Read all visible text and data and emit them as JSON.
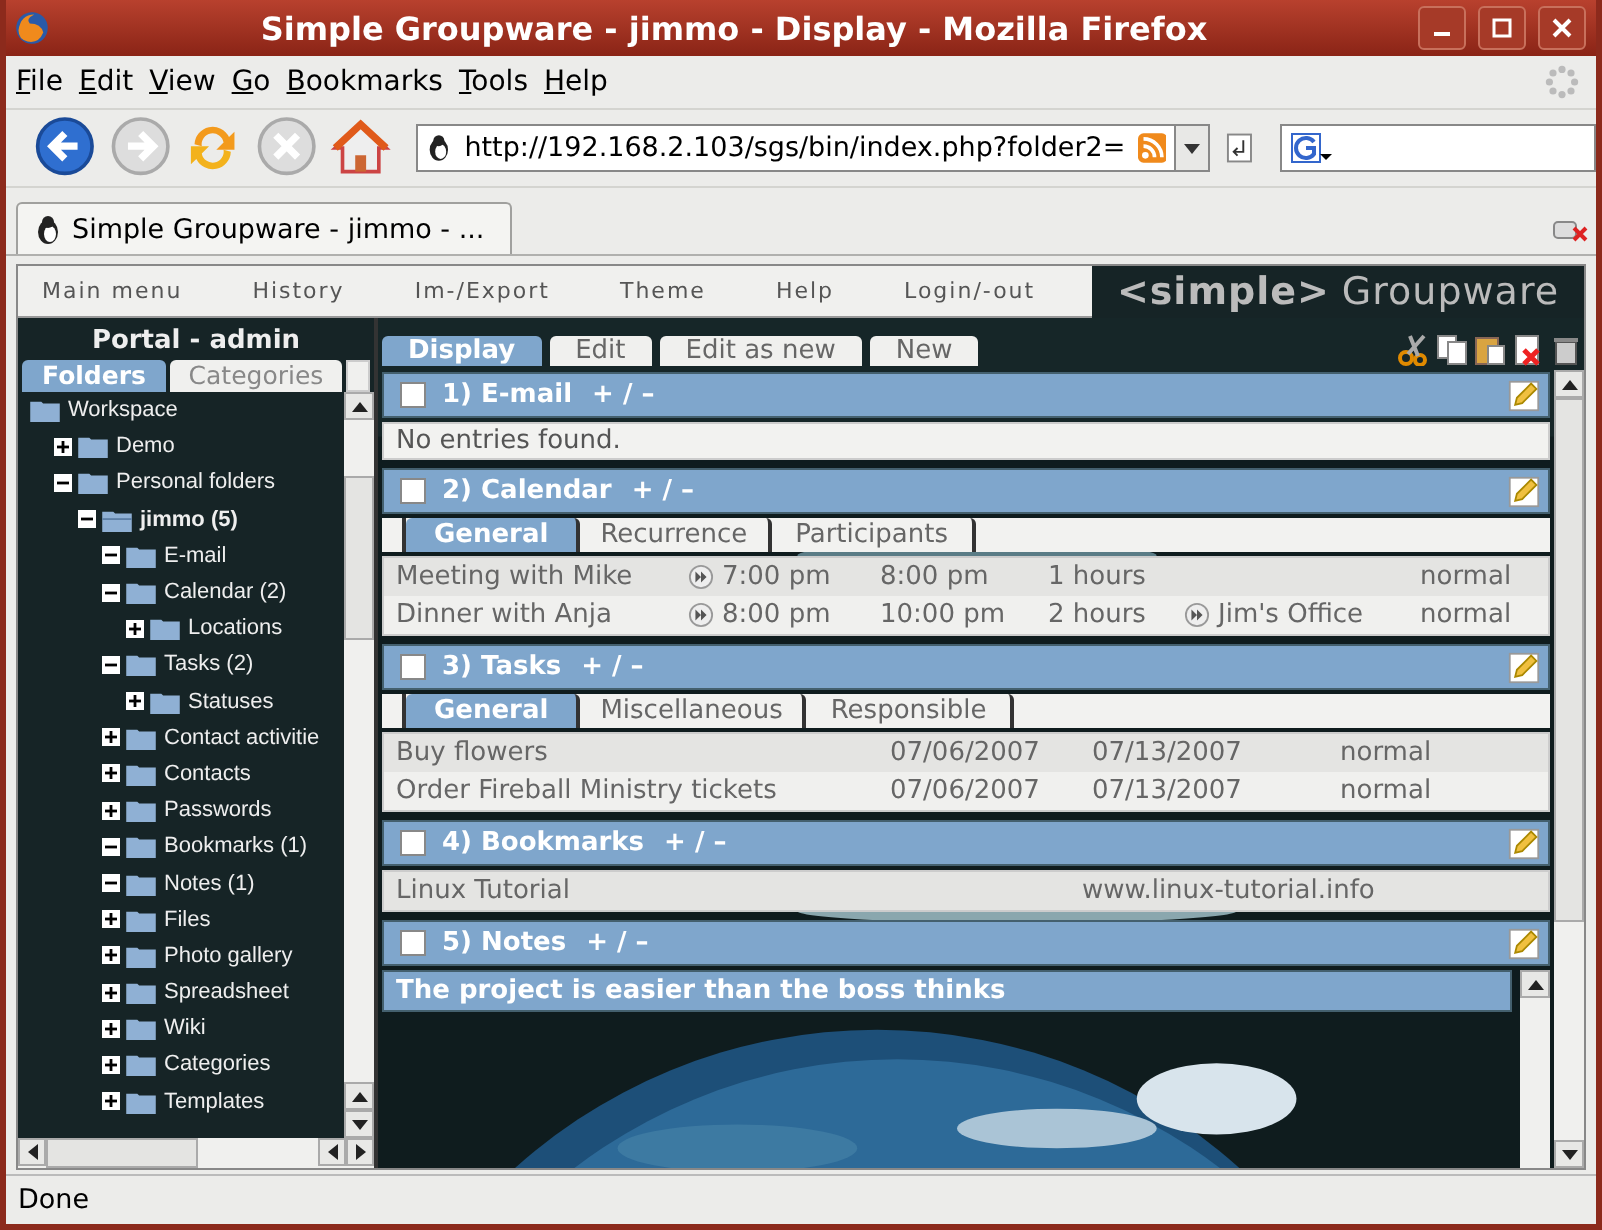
{
  "window": {
    "title": "Simple Groupware - jimmo - Display - Mozilla Firefox"
  },
  "menu": [
    "File",
    "Edit",
    "View",
    "Go",
    "Bookmarks",
    "Tools",
    "Help"
  ],
  "address": {
    "value": "http://192.168.2.103/sgs/bin/index.php?folder2="
  },
  "browser_tabs": [
    {
      "label": "Simple Groupware - jimmo - ...",
      "selected": true
    }
  ],
  "app_menu": [
    "Main menu",
    "History",
    "Im-/Export",
    "Theme",
    "Help",
    "Login/-out"
  ],
  "logo": {
    "bracket": "<simple>",
    "name": "Groupware"
  },
  "sidebar": {
    "title": "Portal - admin",
    "tabs": [
      {
        "label": "Folders",
        "selected": true
      },
      {
        "label": "Categories",
        "selected": false
      }
    ],
    "tree": [
      {
        "label": "Workspace",
        "selected": false,
        "children": [
          {
            "label": "Demo",
            "expanded": false,
            "selected": false
          },
          {
            "label": "Personal folders",
            "expanded": true,
            "selected": false,
            "children": [
              {
                "label": "jimmo (5)",
                "expanded": true,
                "selected": true,
                "children": [
                  {
                    "label": "E-mail",
                    "expanded": true,
                    "selected": false
                  },
                  {
                    "label": "Calendar (2)",
                    "expanded": true,
                    "selected": false,
                    "children": [
                      {
                        "label": "Locations",
                        "expanded": false,
                        "selected": false
                      }
                    ]
                  },
                  {
                    "label": "Tasks (2)",
                    "expanded": true,
                    "selected": false,
                    "children": [
                      {
                        "label": "Statuses",
                        "expanded": false,
                        "selected": false
                      }
                    ]
                  },
                  {
                    "label": "Contact activitie",
                    "expanded": false,
                    "selected": false
                  },
                  {
                    "label": "Contacts",
                    "expanded": false,
                    "selected": false
                  },
                  {
                    "label": "Passwords",
                    "expanded": false,
                    "selected": false
                  },
                  {
                    "label": "Bookmarks (1)",
                    "expanded": true,
                    "selected": false
                  },
                  {
                    "label": "Notes (1)",
                    "expanded": true,
                    "selected": false
                  },
                  {
                    "label": "Files",
                    "expanded": false,
                    "selected": false
                  },
                  {
                    "label": "Photo gallery",
                    "expanded": false,
                    "selected": false
                  },
                  {
                    "label": "Spreadsheet",
                    "expanded": false,
                    "selected": false
                  },
                  {
                    "label": "Wiki",
                    "expanded": false,
                    "selected": false
                  },
                  {
                    "label": "Categories",
                    "expanded": false,
                    "selected": false
                  },
                  {
                    "label": "Templates",
                    "expanded": false,
                    "selected": false
                  }
                ]
              }
            ]
          }
        ]
      }
    ]
  },
  "view_tabs": [
    {
      "label": "Display",
      "selected": true
    },
    {
      "label": "Edit",
      "selected": false
    },
    {
      "label": "Edit as new",
      "selected": false
    },
    {
      "label": "New",
      "selected": false
    }
  ],
  "sections": [
    {
      "kind": "email",
      "title": "1) E-mail",
      "controls": "+ / –",
      "checked": false,
      "message": "No entries found."
    },
    {
      "kind": "calendar",
      "title": "2) Calendar",
      "controls": "+ / –",
      "checked": false,
      "tabs": [
        {
          "label": "General",
          "selected": true
        },
        {
          "label": "Recurrence",
          "selected": false
        },
        {
          "label": "Participants",
          "selected": false
        }
      ],
      "rows": [
        [
          {
            "kind": "text",
            "text": "Meeting with Mike"
          },
          {
            "kind": "link",
            "text": "7:00 pm"
          },
          {
            "kind": "text",
            "text": "8:00 pm"
          },
          {
            "kind": "text",
            "text": "1 hours"
          },
          {
            "kind": "blank"
          },
          {
            "kind": "text",
            "text": "normal"
          }
        ],
        [
          {
            "kind": "text",
            "text": "Dinner with Anja"
          },
          {
            "kind": "link",
            "text": "8:00 pm"
          },
          {
            "kind": "text",
            "text": "10:00 pm"
          },
          {
            "kind": "text",
            "text": "2 hours"
          },
          {
            "kind": "link",
            "text": "Jim's Office"
          },
          {
            "kind": "text",
            "text": "normal"
          }
        ]
      ]
    },
    {
      "kind": "tasks",
      "title": "3) Tasks",
      "controls": "+ / –",
      "checked": false,
      "tabs": [
        {
          "label": "General",
          "selected": true
        },
        {
          "label": "Miscellaneous",
          "selected": false
        },
        {
          "label": "Responsible",
          "selected": false
        }
      ],
      "rows": [
        [
          {
            "kind": "text",
            "text": "Buy flowers"
          },
          {
            "kind": "text",
            "text": "07/06/2007"
          },
          {
            "kind": "text",
            "text": "07/13/2007"
          },
          {
            "kind": "text",
            "text": "normal"
          }
        ],
        [
          {
            "kind": "text",
            "text": "Order Fireball Ministry tickets"
          },
          {
            "kind": "text",
            "text": "07/06/2007"
          },
          {
            "kind": "text",
            "text": "07/13/2007"
          },
          {
            "kind": "text",
            "text": "normal"
          }
        ]
      ]
    },
    {
      "kind": "bookmarks",
      "title": "4) Bookmarks",
      "controls": "+ / –",
      "checked": false,
      "rows": [
        [
          {
            "kind": "text",
            "text": "Linux Tutorial"
          },
          {
            "kind": "text",
            "text": "www.linux-tutorial.info"
          }
        ]
      ]
    },
    {
      "kind": "notes",
      "title": "5) Notes",
      "controls": "+ / –",
      "checked": false,
      "note": "The project is easier than the boss thinks"
    }
  ],
  "status_bar": "Done"
}
